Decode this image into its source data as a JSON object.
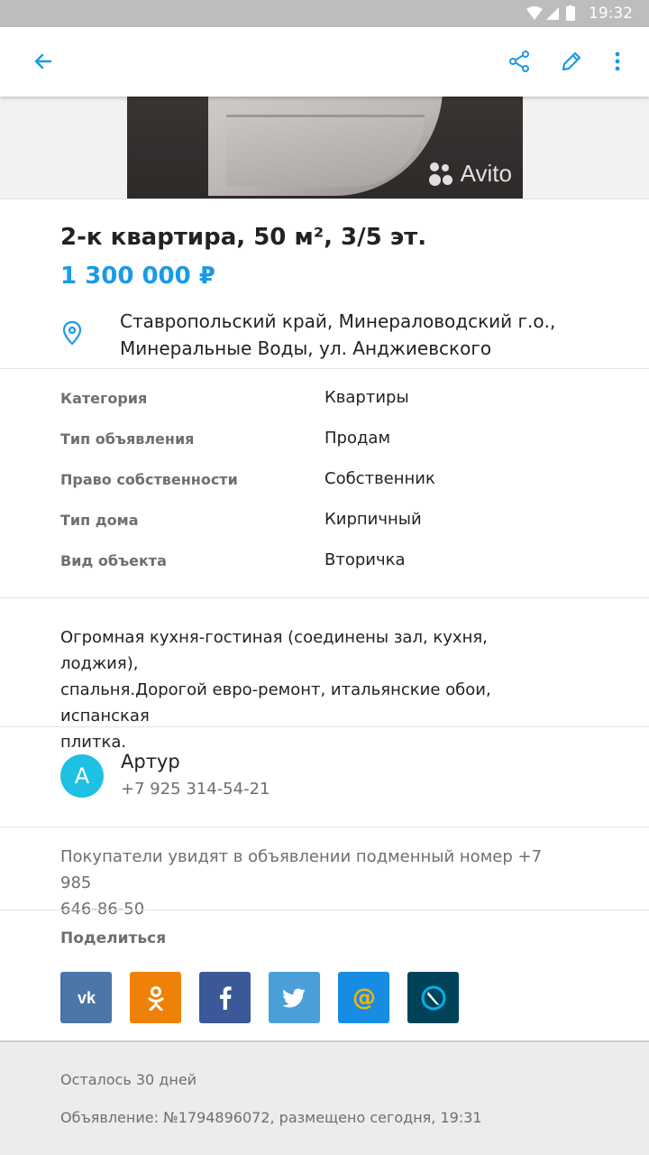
{
  "status_bar": {
    "time": "19:32"
  },
  "toolbar": {
    "back_icon": "arrow-left-icon",
    "share_icon": "share-icon",
    "edit_icon": "pencil-icon",
    "more_icon": "more-vertical-icon",
    "accent_color": "#1a9ae6"
  },
  "photo": {
    "watermark": "Avito"
  },
  "listing": {
    "title": "2-к квартира, 50 м², 3/5 эт.",
    "price": "1 300 000 ₽",
    "address_line1": "Ставропольский край, Минераловодский г.о.,",
    "address_line2": "Минеральные Воды, ул. Анджиевского"
  },
  "params": [
    {
      "key": "Категория",
      "value": "Квартиры"
    },
    {
      "key": "Тип объявления",
      "value": "Продам"
    },
    {
      "key": "Право собственности",
      "value": "Собственник"
    },
    {
      "key": "Тип дома",
      "value": "Кирпичный"
    },
    {
      "key": "Вид объекта",
      "value": "Вторичка"
    }
  ],
  "description": {
    "line1": "Огромная кухня-гостиная (соединены зал, кухня, лоджия),",
    "line2": "спальня.Дорогой евро-ремонт, итальянские обои, испанская",
    "line3": "плитка."
  },
  "seller": {
    "initial": "А",
    "name": "Артур",
    "phone": "+7 925 314-54-21",
    "avatar_color": "#1ec0e4"
  },
  "notice": {
    "line1": "Покупатели увидят в объявлении подменный номер +7 985",
    "line2": "646-86-50"
  },
  "share": {
    "label": "Поделиться",
    "buttons": [
      {
        "name": "vk",
        "glyph": "vk",
        "color": "#4a76a8"
      },
      {
        "name": "odnoklassniki",
        "glyph": "ok",
        "color": "#ee8208"
      },
      {
        "name": "facebook",
        "glyph": "f",
        "color": "#3b5998"
      },
      {
        "name": "twitter",
        "glyph": "t",
        "color": "#4a9fd8"
      },
      {
        "name": "mail",
        "glyph": "@",
        "color": "#168de2"
      },
      {
        "name": "livejournal",
        "glyph": "lj",
        "color": "#004359"
      }
    ]
  },
  "footer": {
    "remaining": "Осталось 30 дней",
    "ad_info": "Объявление: №1794896072, размещено сегодня, 19:31"
  }
}
